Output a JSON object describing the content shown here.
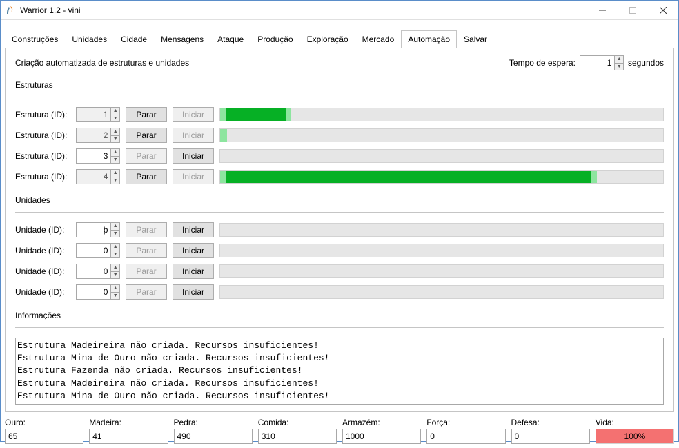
{
  "window": {
    "title": "Warrior 1.2 - vini"
  },
  "tabs": [
    "Construções",
    "Unidades",
    "Cidade",
    "Mensagens",
    "Ataque",
    "Produção",
    "Exploração",
    "Mercado",
    "Automação",
    "Salvar"
  ],
  "active_tab_index": 8,
  "auto": {
    "description": "Criação automatizada de estruturas e unidades",
    "wait_label": "Tempo de espera:",
    "wait_value": "1",
    "wait_unit": "segundos",
    "structures_title": "Estruturas",
    "structure_label": "Estrutura (ID):",
    "units_title": "Unidades",
    "unit_label": "Unidade (ID):",
    "btn_stop": "Parar",
    "btn_start": "Iniciar",
    "structures": [
      {
        "id": "1",
        "spin_disabled": true,
        "stop_disabled": false,
        "start_disabled": true,
        "progress": 16
      },
      {
        "id": "2",
        "spin_disabled": true,
        "stop_disabled": false,
        "start_disabled": true,
        "progress": 1.5
      },
      {
        "id": "3",
        "spin_disabled": false,
        "stop_disabled": true,
        "start_disabled": false,
        "progress": 0
      },
      {
        "id": "4",
        "spin_disabled": true,
        "stop_disabled": false,
        "start_disabled": true,
        "progress": 85
      }
    ],
    "units": [
      {
        "id": "0",
        "spin_disabled": false,
        "stop_disabled": true,
        "start_disabled": false,
        "progress": 0,
        "display": "þ"
      },
      {
        "id": "0",
        "spin_disabled": false,
        "stop_disabled": true,
        "start_disabled": false,
        "progress": 0,
        "display": "0"
      },
      {
        "id": "0",
        "spin_disabled": false,
        "stop_disabled": true,
        "start_disabled": false,
        "progress": 0,
        "display": "0"
      },
      {
        "id": "0",
        "spin_disabled": false,
        "stop_disabled": true,
        "start_disabled": false,
        "progress": 0,
        "display": "0"
      }
    ],
    "info_title": "Informações",
    "info_lines": [
      "Estrutura Madeireira não criada. Recursos insuficientes!",
      "Estrutura Mina de Ouro não criada. Recursos insuficientes!",
      "Estrutura Fazenda não criada. Recursos insuficientes!",
      "Estrutura Madeireira não criada. Recursos insuficientes!",
      "Estrutura Mina de Ouro não criada. Recursos insuficientes!"
    ]
  },
  "status": {
    "ouro": {
      "label": "Ouro:",
      "value": "65"
    },
    "madeira": {
      "label": "Madeira:",
      "value": "41"
    },
    "pedra": {
      "label": "Pedra:",
      "value": "490"
    },
    "comida": {
      "label": "Comida:",
      "value": "310"
    },
    "armazem": {
      "label": "Armazém:",
      "value": "1000"
    },
    "forca": {
      "label": "Força:",
      "value": "0"
    },
    "defesa": {
      "label": "Defesa:",
      "value": "0"
    },
    "vida": {
      "label": "Vida:",
      "value": "100%",
      "pct": 100
    }
  }
}
